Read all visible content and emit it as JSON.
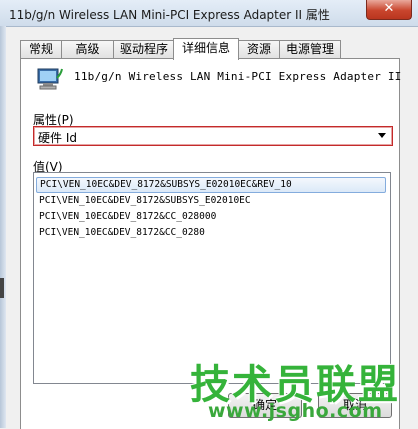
{
  "window": {
    "title": "11b/g/n  Wireless LAN Mini-PCI Express Adapter II 属性",
    "close_glyph": "✕"
  },
  "tabs": [
    {
      "label": "常规",
      "active": false
    },
    {
      "label": "高级",
      "active": false
    },
    {
      "label": "驱动程序",
      "active": false
    },
    {
      "label": "详细信息",
      "active": true
    },
    {
      "label": "资源",
      "active": false
    },
    {
      "label": "电源管理",
      "active": false
    }
  ],
  "device": {
    "icon": "network-adapter-icon",
    "name": "11b/g/n  Wireless LAN Mini-PCI Express Adapter II"
  },
  "property": {
    "label": "属性(P)",
    "selected": "硬件 Id"
  },
  "value": {
    "label": "值(V)",
    "items": [
      "PCI\\VEN_10EC&DEV_8172&SUBSYS_E02010EC&REV_10",
      "PCI\\VEN_10EC&DEV_8172&SUBSYS_E02010EC",
      "PCI\\VEN_10EC&DEV_8172&CC_028000",
      "PCI\\VEN_10EC&DEV_8172&CC_0280"
    ],
    "selected_index": 0
  },
  "buttons": {
    "ok": "确定",
    "cancel": "取消"
  },
  "watermark": {
    "title": "技术员联盟",
    "url": "www.jsgho.com"
  },
  "colors": {
    "highlight_border": "#c42a2a",
    "watermark_green": "#35b33a"
  }
}
